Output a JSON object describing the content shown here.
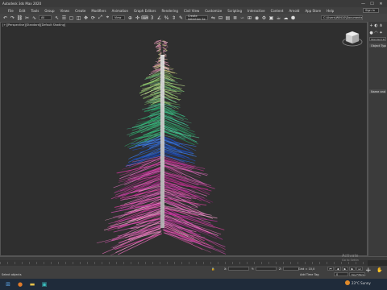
{
  "window": {
    "title": "Autodesk 3ds Max 2020",
    "minimize": "—",
    "maximize": "☐",
    "close": "✕"
  },
  "menubar": {
    "items": [
      "File",
      "Edit",
      "Tools",
      "Group",
      "Views",
      "Create",
      "Modifiers",
      "Animation",
      "Graph Editors",
      "Rendering",
      "Civil View",
      "Customize",
      "Scripting",
      "Interactive",
      "Content",
      "Arnold",
      "App Store",
      "Help"
    ],
    "signin": "Sign In"
  },
  "toolbar": {
    "filter_select": "All",
    "view_select": "View",
    "selection_set": "Create Selection Se",
    "path": "C:\\Users\\WIN10\\Documents\\3ds Max 2020"
  },
  "viewport": {
    "label": "[+][Perspective][Standard][Default Shading]"
  },
  "command_panel": {
    "dropdown": "Standard Primitives",
    "rollout_object_type": "Object Type",
    "rollout_name_color": "Name and Color"
  },
  "trackbar": {
    "start": "0",
    "end": "100"
  },
  "status": {
    "selection": "None Selected",
    "hint": "Select objects",
    "x_label": "X:",
    "y_label": "Y:",
    "z_label": "Z:",
    "grid": "Grid = 10,0",
    "add_time_tag": "Add Time Tag",
    "auto_key": "Auto Key",
    "set_key": "Set Key",
    "selected": "Selected",
    "key_filters": "Key Filters...",
    "frame": "0"
  },
  "watermark": {
    "line1": "Activate",
    "line2": "Go to Settin"
  },
  "taskbar": {
    "temperature": "23°C",
    "weather": "Sunny"
  },
  "colors": {
    "accent": "#5aa0e0",
    "brand": "#00a3a3"
  }
}
